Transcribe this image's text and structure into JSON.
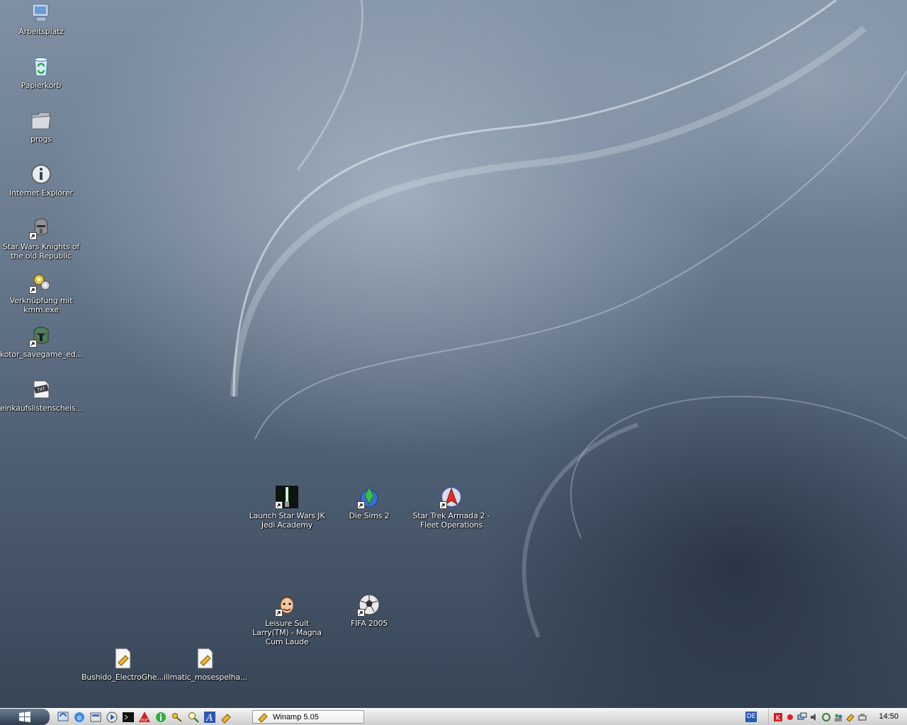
{
  "desktop_icons": {
    "arbeitsplatz": "Arbeitsplatz",
    "papierkorb": "Papierkorb",
    "progs": "progs",
    "internet_explorer": "Internet Explorer",
    "kotor": "Star Wars Knights of the old Republic",
    "kmm": "Verknüpfung mit kmm.exe",
    "kotor_savegame": "kotor_savegame_ed...",
    "einkaufsliste": "einkaufslistenscheis...",
    "jedi_academy": "Launch Star Wars JK Jedi Academy",
    "sims2": "Die Sims 2",
    "armada2": "Star Trek Armada 2 - Fleet Operations",
    "larry": "Leisure Suit Larry(TM) - Magna Cum Laude",
    "fifa": "FIFA 2005",
    "bushido": "Bushido_ElectroGhe...",
    "illmatic": "illmatic_mosespelha..."
  },
  "taskbar": {
    "task_label": "Winamp 5.05",
    "language": "DE",
    "clock": "14:50",
    "quick_launch_icons": [
      "desktop-icon",
      "ie-icon",
      "explorer-icon",
      "media-player-icon",
      "terminal-icon",
      "acrobat-icon",
      "info-icon",
      "keys-icon",
      "search-icon",
      "font-icon",
      "winamp-icon"
    ],
    "tray_icons": [
      "antivirus-icon",
      "record-icon",
      "network-icon",
      "volume-icon",
      "sync-icon",
      "people-icon",
      "winamp-tray-icon",
      "usb-icon"
    ]
  },
  "colors": {
    "wallpaper_top": "#7f90a3",
    "wallpaper_bottom": "#374557",
    "taskbar": "#e2e2e2",
    "start_button": "#45566b"
  }
}
